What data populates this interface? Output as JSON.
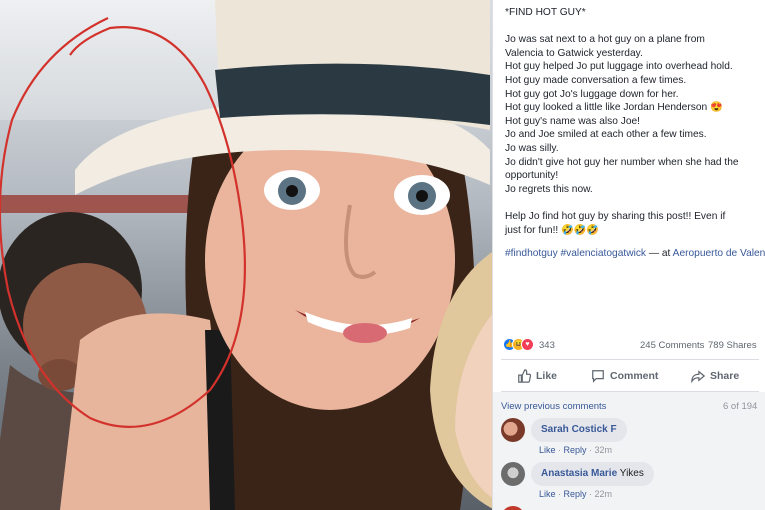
{
  "post": {
    "lines": [
      "*FIND HOT GUY*",
      "",
      "Jo was sat next to a hot guy on a plane from",
      "Valencia to Gatwick yesterday.",
      "Hot guy helped Jo put luggage into overhead hold.",
      "Hot guy made conversation a few times.",
      "Hot guy got Jo's luggage down for her.",
      "Hot guy looked a little like Jordan Henderson 😍",
      "Hot guy's name was also Joe!",
      "Jo and Joe smiled at each other a few times.",
      "Jo was silly.",
      "Jo didn't give hot guy her number when she had the",
      "opportunity!",
      "Jo regrets this now.",
      "",
      "Help Jo find hot guy by sharing this post!! Even if",
      "just for fun!! 🤣🤣🤣"
    ],
    "hashtags": "#findhotguy #valenciatogatwick",
    "at_text": " — at ",
    "location": "Aeropuerto de Valencia."
  },
  "reactions": {
    "count": "343",
    "comments": "245 Comments",
    "shares": "789 Shares"
  },
  "actions": {
    "like": "Like",
    "comment": "Comment",
    "share": "Share"
  },
  "comments_section": {
    "view_previous": "View previous comments",
    "count_of": "6 of 194",
    "items": [
      {
        "author": "Sarah Costick F",
        "text": "",
        "like": "Like",
        "reply": "Reply",
        "time": "32m"
      },
      {
        "author": "Anastasia Marie",
        "text": "Yikes",
        "like": "Like",
        "reply": "Reply",
        "time": "22m"
      }
    ]
  },
  "colors": {
    "link": "#385898",
    "circle": "#d3322c",
    "like_blue": "#1877f2"
  }
}
